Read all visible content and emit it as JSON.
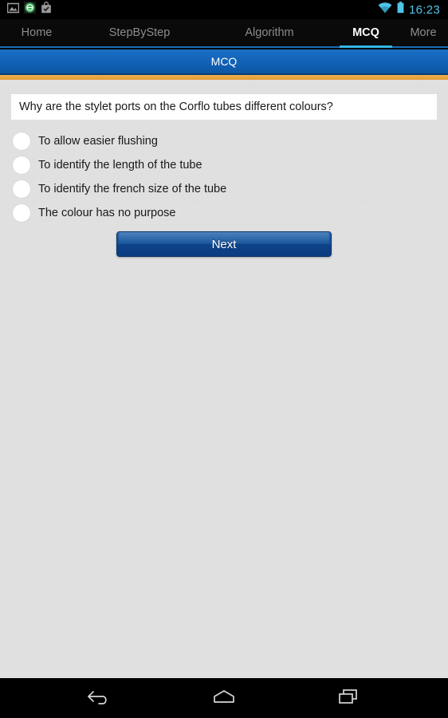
{
  "status_bar": {
    "icons": [
      {
        "name": "gallery-icon"
      },
      {
        "name": "green-circle-sync-icon"
      },
      {
        "name": "play-store-bag-check-icon"
      }
    ],
    "wifi_icon": "wifi-icon",
    "battery_icon": "battery-icon",
    "time": "16:23",
    "time_color": "#4FC3E8"
  },
  "tabs": [
    {
      "label": "Home",
      "active": false
    },
    {
      "label": "StepByStep",
      "active": false
    },
    {
      "label": "Algorithm",
      "active": false
    },
    {
      "label": "MCQ",
      "active": true
    },
    {
      "label": "More",
      "active": false
    }
  ],
  "title_bar": {
    "title": "MCQ",
    "background_color": "#1264B8",
    "accent_stripe_color": "#E49B33"
  },
  "quiz": {
    "question": "Why are the stylet ports on the Corflo tubes different colours?",
    "options": [
      {
        "label": "To allow easier flushing",
        "selected": false
      },
      {
        "label": "To identify the length of the tube",
        "selected": false
      },
      {
        "label": "To identify the french size of the tube",
        "selected": false
      },
      {
        "label": "The colour has no purpose",
        "selected": false
      }
    ],
    "next_label": "Next",
    "next_button_color": "#12559C"
  },
  "nav_bar": {
    "buttons": [
      {
        "name": "back-button",
        "icon": "back-arrow-icon"
      },
      {
        "name": "home-button",
        "icon": "home-icon"
      },
      {
        "name": "recent-apps-button",
        "icon": "recent-apps-icon"
      }
    ]
  },
  "background_color": "#E3E3E3"
}
